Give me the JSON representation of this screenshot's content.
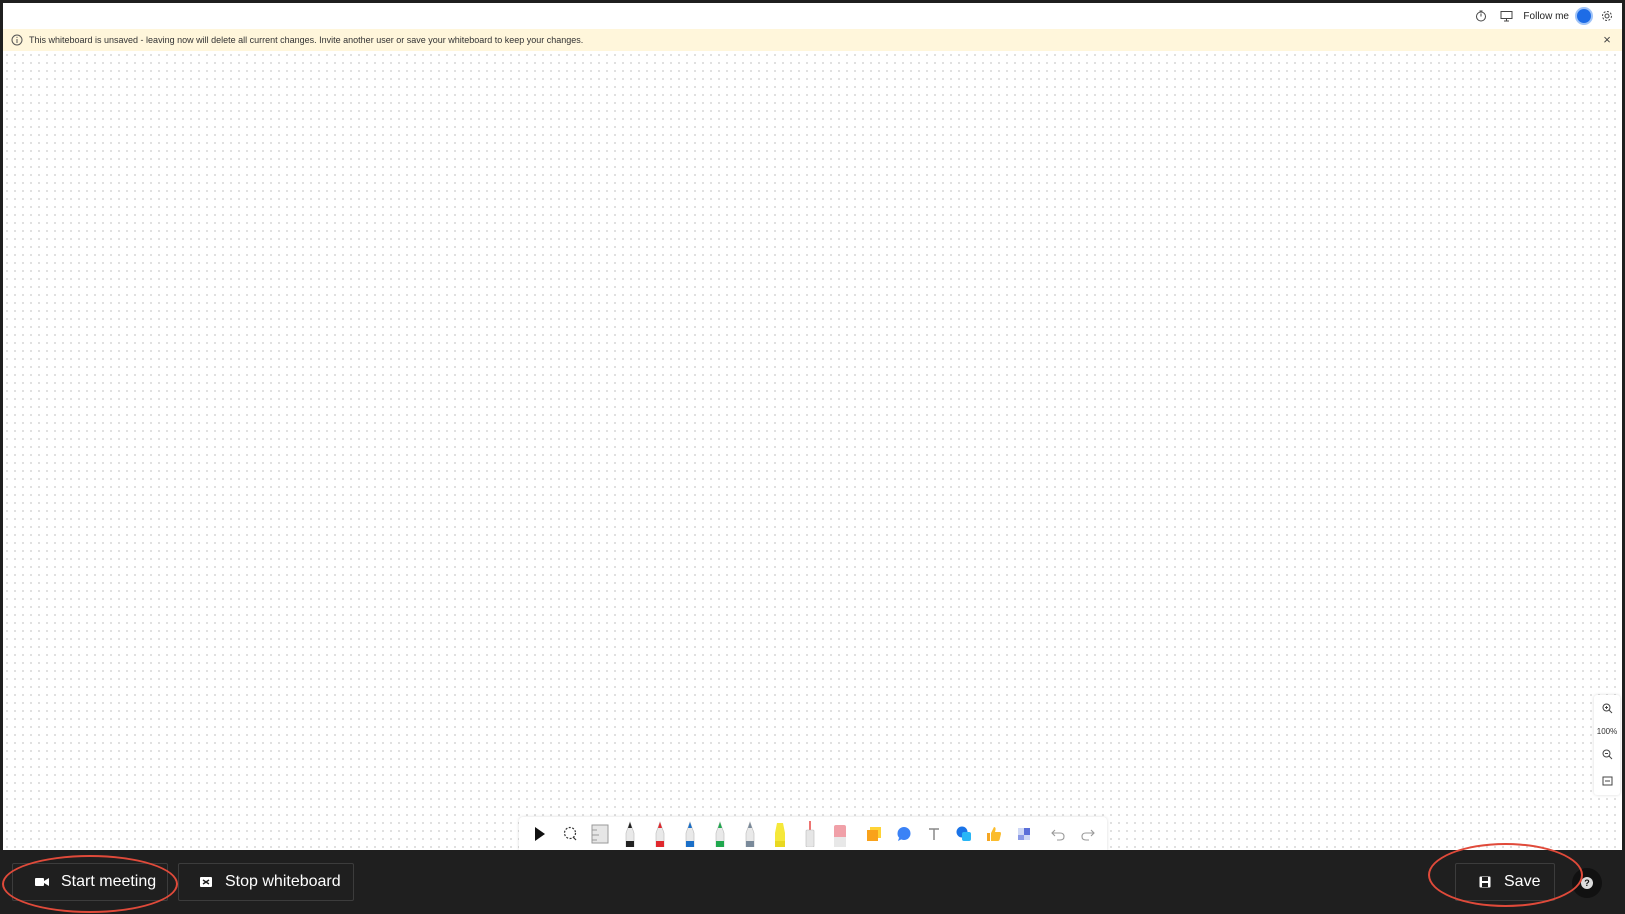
{
  "header": {
    "follow_label": "Follow me",
    "icons": [
      "timer-icon",
      "present-icon",
      "avatar",
      "settings-icon"
    ]
  },
  "banner": {
    "message": "This whiteboard is unsaved - leaving now will delete all current changes. Invite another user or save your whiteboard to keep your changes.",
    "icon": "info-icon",
    "close_icon": "close-icon"
  },
  "toolbar": {
    "tools": [
      {
        "name": "select-tool",
        "icon": "pointer-icon"
      },
      {
        "name": "lasso-tool",
        "icon": "lasso-icon"
      },
      {
        "name": "ruler-tool",
        "icon": "ruler-icon"
      },
      {
        "name": "pen-black",
        "color": "#222222"
      },
      {
        "name": "pen-red",
        "color": "#e0282e"
      },
      {
        "name": "pen-blue",
        "color": "#1a6fc8"
      },
      {
        "name": "pen-green",
        "color": "#20a84e"
      },
      {
        "name": "pen-gray",
        "color": "#7a8a9a"
      },
      {
        "name": "highlighter-yellow",
        "color": "#f5e83a"
      },
      {
        "name": "laser-pointer",
        "color": "#e53935"
      },
      {
        "name": "eraser",
        "color": "#f0a0a8"
      },
      {
        "name": "sticky-note",
        "icon": "sticky-note-icon"
      },
      {
        "name": "comment",
        "icon": "comment-icon"
      },
      {
        "name": "text",
        "icon": "text-icon"
      },
      {
        "name": "shapes",
        "icon": "shapes-icon"
      },
      {
        "name": "reactions",
        "icon": "thumbs-up-icon"
      },
      {
        "name": "templates",
        "icon": "templates-icon"
      },
      {
        "name": "undo",
        "icon": "undo-icon"
      },
      {
        "name": "redo",
        "icon": "redo-icon"
      }
    ]
  },
  "zoom": {
    "level": "100%"
  },
  "bottom": {
    "start_meeting": "Start meeting",
    "stop_whiteboard": "Stop whiteboard",
    "save": "Save",
    "help_glyph": "?"
  },
  "colors": {
    "bar_bg": "#1f1f1f",
    "banner_bg": "#fff6db",
    "annotation": "#e04a3a",
    "accent": "#1e6ce6"
  }
}
